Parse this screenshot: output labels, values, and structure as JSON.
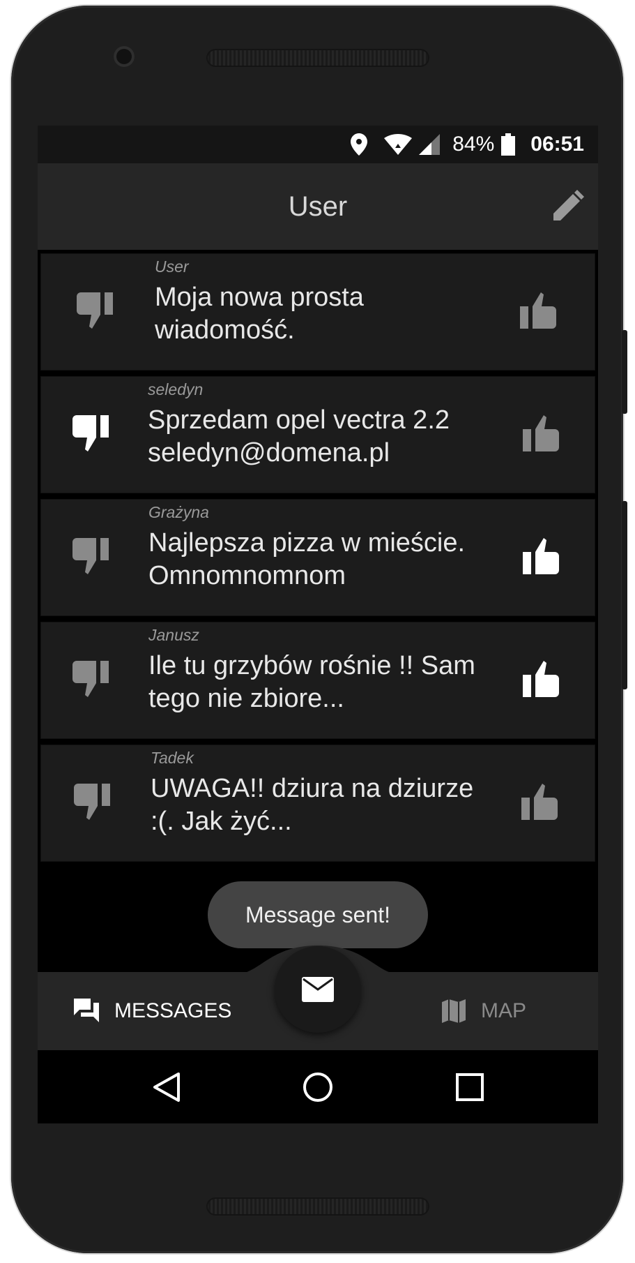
{
  "status_bar": {
    "battery": "84%",
    "time": "06:51",
    "icons": [
      "location-icon",
      "wifi-icon",
      "signal-icon",
      "battery-icon"
    ]
  },
  "app_bar": {
    "title": "User",
    "edit_icon": "pencil-icon"
  },
  "messages": [
    {
      "author": "User",
      "text": "Moja nowa prosta wiadomość.",
      "dislike_active": false,
      "like_active": false
    },
    {
      "author": "seledyn",
      "text": "Sprzedam opel vectra 2.2 seledyn@domena.pl",
      "dislike_active": true,
      "like_active": false
    },
    {
      "author": "Grażyna",
      "text": "Najlepsza pizza w mieście. Omnomnomnom",
      "dislike_active": false,
      "like_active": true
    },
    {
      "author": "Janusz",
      "text": "Ile tu grzybów rośnie !! Sam tego nie zbiore...",
      "dislike_active": false,
      "like_active": true
    },
    {
      "author": "Tadek",
      "text": "UWAGA!! dziura na dziurze :(.  Jak żyć...",
      "dislike_active": false,
      "like_active": false
    }
  ],
  "toast": {
    "text": "Message sent!"
  },
  "bottom_nav": {
    "messages_label": "MESSAGES",
    "map_label": "MAP",
    "fab_icon": "envelope-icon"
  },
  "colors": {
    "active": "#ffffff",
    "inactive": "#8a8a8a",
    "card": "#1c1c1c",
    "appbar": "#262626"
  }
}
